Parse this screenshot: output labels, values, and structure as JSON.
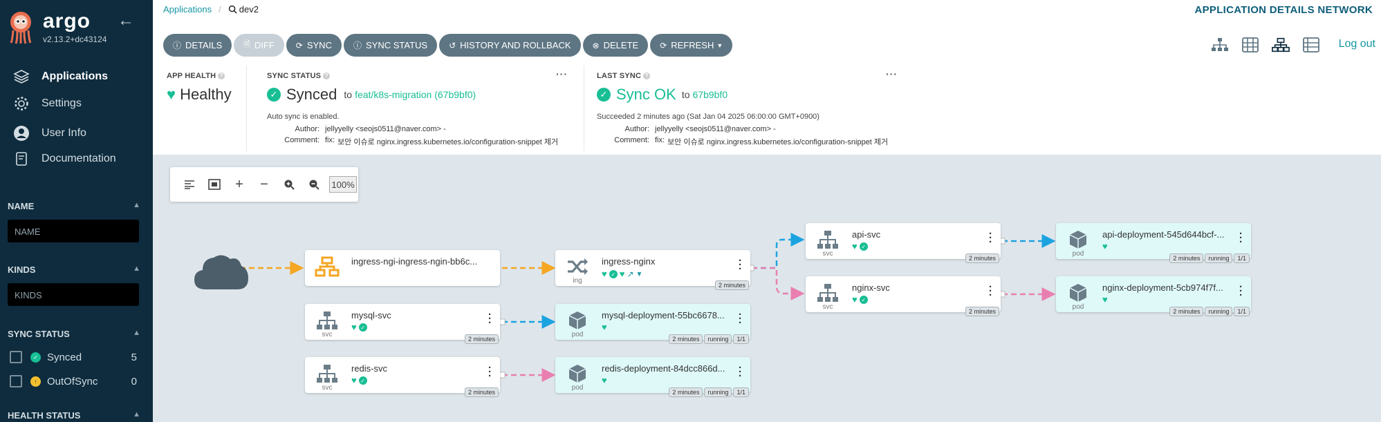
{
  "sidebar": {
    "brand": "argo",
    "version": "v2.13.2+dc43124",
    "nav": [
      {
        "label": "Applications",
        "icon": "layers-icon",
        "active": true
      },
      {
        "label": "Settings",
        "icon": "gear-icon",
        "active": false
      },
      {
        "label": "User Info",
        "icon": "user-icon",
        "active": false
      },
      {
        "label": "Documentation",
        "icon": "book-icon",
        "active": false
      }
    ],
    "name_filter": {
      "title": "NAME",
      "placeholder": "NAME"
    },
    "kinds_filter": {
      "title": "KINDS",
      "placeholder": "KINDS"
    },
    "sync_status": {
      "title": "SYNC STATUS",
      "items": [
        {
          "label": "Synced",
          "count": "5"
        },
        {
          "label": "OutOfSync",
          "count": "0"
        }
      ]
    },
    "health_status": {
      "title": "HEALTH STATUS"
    }
  },
  "header": {
    "breadcrumb_root": "Applications",
    "breadcrumb_app": "dev2",
    "page_title": "APPLICATION DETAILS NETWORK"
  },
  "toolbar": {
    "details": "DETAILS",
    "diff": "DIFF",
    "sync": "SYNC",
    "sync_status": "SYNC STATUS",
    "history": "HISTORY AND ROLLBACK",
    "delete": "DELETE",
    "refresh": "REFRESH"
  },
  "logout": "Log out",
  "status": {
    "app_health": {
      "label": "APP HEALTH",
      "value": "Healthy"
    },
    "sync_status": {
      "label": "SYNC STATUS",
      "value": "Synced",
      "to": "to",
      "target": "feat/k8s-migration (67b9bf0)",
      "auto_sync": "Auto sync is enabled.",
      "author_key": "Author:",
      "author": "jellyyelly <seojs0511@naver.com> -",
      "comment_key": "Comment:",
      "comment_prefix": "fix:",
      "comment": "보안 이슈로 nginx.ingress.kubernetes.io/configuration-snippet 제거"
    },
    "last_sync": {
      "label": "LAST SYNC",
      "value": "Sync OK",
      "to": "to",
      "target": "67b9bf0",
      "succeeded": "Succeeded 2 minutes ago (Sat Jan 04 2025 06:00:00 GMT+0900)",
      "author_key": "Author:",
      "author": "jellyyelly <seojs0511@naver.com> -",
      "comment_key": "Comment:",
      "comment_prefix": "fix:",
      "comment": "보안 이슈로 nginx.ingress.kubernetes.io/configuration-snippet 제거"
    }
  },
  "graph": {
    "zoom": "100%",
    "nodes": [
      {
        "id": "ingress-ngi",
        "name": "ingress-ngi-ingress-ngin-bb6c...",
        "kind": "",
        "icon": "network-icon"
      },
      {
        "id": "ingress-nginx",
        "name": "ingress-nginx",
        "kind": "ing",
        "age": "2 minutes",
        "icon": "shuffle-icon"
      },
      {
        "id": "api-svc",
        "name": "api-svc",
        "kind": "svc",
        "age": "2 minutes",
        "icon": "sitemap-icon"
      },
      {
        "id": "nginx-svc",
        "name": "nginx-svc",
        "kind": "svc",
        "age": "2 minutes",
        "icon": "sitemap-icon"
      },
      {
        "id": "mysql-svc",
        "name": "mysql-svc",
        "kind": "svc",
        "age": "2 minutes",
        "icon": "sitemap-icon"
      },
      {
        "id": "redis-svc",
        "name": "redis-svc",
        "kind": "svc",
        "age": "2 minutes",
        "icon": "sitemap-icon"
      },
      {
        "id": "api-deploy",
        "name": "api-deployment-545d644bcf-...",
        "kind": "pod",
        "age": "2 minutes",
        "state": "running",
        "ready": "1/1",
        "icon": "cube-icon"
      },
      {
        "id": "nginx-deploy",
        "name": "nginx-deployment-5cb974f7f...",
        "kind": "pod",
        "age": "2 minutes",
        "state": "running",
        "ready": "1/1",
        "icon": "cube-icon"
      },
      {
        "id": "mysql-deploy",
        "name": "mysql-deployment-55bc6678...",
        "kind": "pod",
        "age": "2 minutes",
        "state": "running",
        "ready": "1/1",
        "icon": "cube-icon"
      },
      {
        "id": "redis-deploy",
        "name": "redis-deployment-84dcc866d...",
        "kind": "pod",
        "age": "2 minutes",
        "state": "running",
        "ready": "1/1",
        "icon": "cube-icon"
      }
    ]
  },
  "colors": {
    "sidebar_bg": "#0e2c3e",
    "accent": "#18be94",
    "link": "#1496a1",
    "edge_orange": "#f5a623",
    "edge_blue": "#1ba3e0",
    "edge_pink": "#e97fb0"
  }
}
